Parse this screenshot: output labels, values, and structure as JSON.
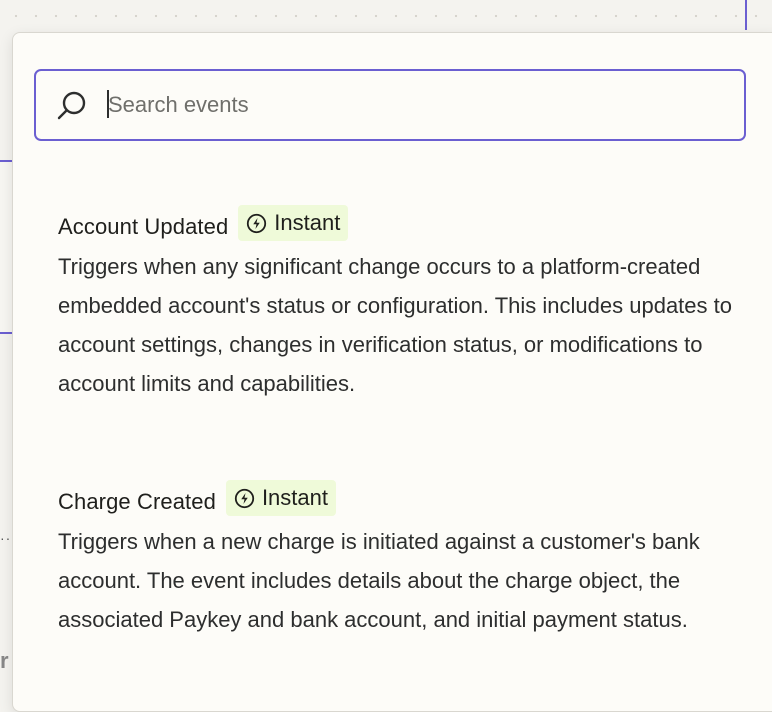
{
  "search": {
    "placeholder": "Search events",
    "value": ""
  },
  "events": [
    {
      "title": "Account Updated",
      "badge": "Instant",
      "description": "Triggers when any significant change occurs to a platform-created embedded account's status or configuration. This includes updates to account settings, changes in verification status, or modifications to account limits and capabilities."
    },
    {
      "title": "Charge Created",
      "badge": "Instant",
      "description": "Triggers when a new charge is initiated against a customer's bank account. The event includes details about the charge object, the associated Paykey and bank account, and initial payment status."
    }
  ],
  "icons": {
    "search": "search-icon",
    "instant": "lightning-bolt-circle-icon"
  },
  "colors": {
    "accent": "#6b5fd1",
    "badge_bg": "#effad9",
    "text": "#1f1f1c",
    "panel_bg": "#fdfcf8"
  }
}
